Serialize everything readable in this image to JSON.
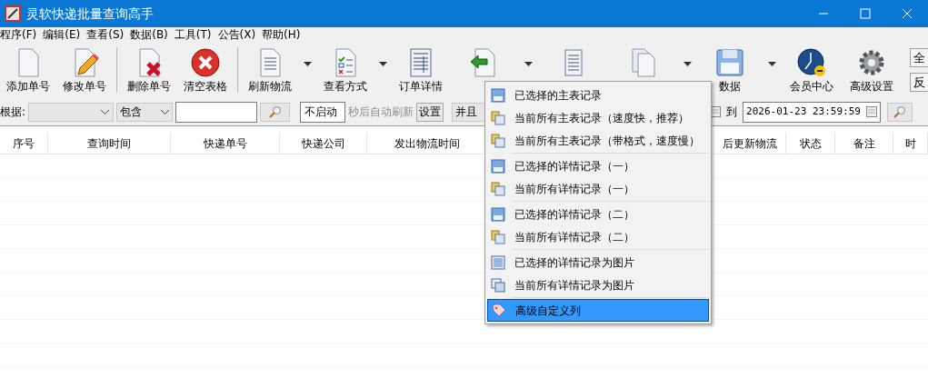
{
  "window": {
    "title": "灵软快递批量查询高手"
  },
  "menu_bar": [
    "程序(F)",
    "编辑(E)",
    "查看(S)",
    "数据(B)",
    "工具(T)",
    "公告(X)",
    "帮助(H)"
  ],
  "toolbar": [
    {
      "kind": "page",
      "label": "添加单号",
      "dropdown": false
    },
    {
      "kind": "pencil",
      "label": "修改单号",
      "dropdown": false
    },
    {
      "kind": "separator"
    },
    {
      "kind": "delete",
      "label": "删除单号",
      "dropdown": false
    },
    {
      "kind": "clear",
      "label": "清空表格",
      "dropdown": false
    },
    {
      "kind": "separator"
    },
    {
      "kind": "list",
      "label": "刷新物流",
      "dropdown": true
    },
    {
      "kind": "checklist",
      "label": "查看方式",
      "dropdown": true
    },
    {
      "kind": "detail",
      "label": "订单详情",
      "dropdown": false
    },
    {
      "kind": "export",
      "dropdown": true
    },
    {
      "kind": "scroll",
      "dropdown": false
    },
    {
      "kind": "copy",
      "dropdown": true
    },
    {
      "kind": "save",
      "label": "数据",
      "dropdown": true
    },
    {
      "kind": "clock",
      "label": "会员中心",
      "dropdown": false
    },
    {
      "kind": "gear",
      "label": "高级设置",
      "dropdown": false
    }
  ],
  "side_buttons": [
    "全",
    "反"
  ],
  "filter": {
    "label": "根据:",
    "match": "包含",
    "refresh_value": "不启动",
    "refresh_label": "秒后自动刷新",
    "settings_button": "设置",
    "logic": "并且",
    "to_label": "到",
    "end_time": "2026-01-23 23:59:59"
  },
  "table": {
    "columns": [
      "序号",
      "查询时间",
      "快递单号",
      "快递公司",
      "发出物流时间",
      "后更新物流",
      "状态",
      "备注",
      "时"
    ]
  },
  "export_menu": [
    {
      "kind": "save",
      "label": "已选择的主表记录",
      "selected": false
    },
    {
      "kind": "copy",
      "label": "当前所有主表记录（速度快，推荐）",
      "selected": false
    },
    {
      "kind": "copy",
      "label": "当前所有主表记录（带格式，速度慢）",
      "selected": false
    },
    {
      "kind": "separator"
    },
    {
      "kind": "save",
      "label": "已选择的详情记录（一）",
      "selected": false
    },
    {
      "kind": "copy",
      "label": "当前所有详情记录（一）",
      "selected": false
    },
    {
      "kind": "separator"
    },
    {
      "kind": "save",
      "label": "已选择的详情记录（二）",
      "selected": false
    },
    {
      "kind": "copy",
      "label": "当前所有详情记录（二）",
      "selected": false
    },
    {
      "kind": "separator"
    },
    {
      "kind": "image",
      "label": "已选择的详情记录为图片",
      "selected": false
    },
    {
      "kind": "images",
      "label": "当前所有详情记录为图片",
      "selected": false
    },
    {
      "kind": "separator"
    },
    {
      "kind": "tag",
      "label": "高级自定义列",
      "selected": true
    }
  ]
}
